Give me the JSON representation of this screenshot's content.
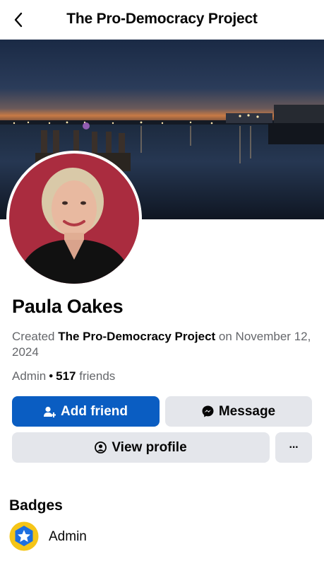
{
  "header": {
    "title": "The Pro-Democracy Project"
  },
  "profile": {
    "name": "Paula Oakes",
    "created_prefix": "Created",
    "group_name": "The Pro-Democracy Project",
    "created_suffix": "on November 12, 2024",
    "role": "Admin",
    "separator": "•",
    "friend_count": "517",
    "friends_label": "friends"
  },
  "actions": {
    "add_friend": "Add friend",
    "message": "Message",
    "view_profile": "View profile",
    "more": "···"
  },
  "badges": {
    "title": "Badges",
    "items": [
      {
        "label": "Admin",
        "icon": "admin-star-badge-icon"
      }
    ]
  },
  "colors": {
    "primary_button": "#0a5dc2",
    "secondary_button": "#e4e6eb",
    "muted_text": "#65676b",
    "badge_ring": "#f5c518",
    "badge_inner": "#1d6fe0"
  }
}
